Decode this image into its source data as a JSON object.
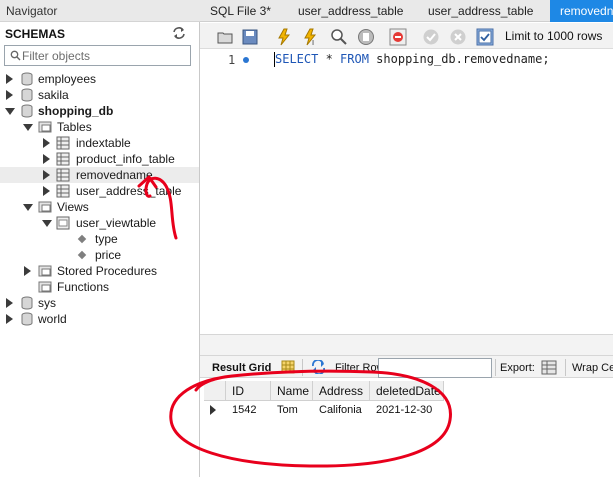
{
  "navigator": {
    "title": "Navigator",
    "schemas_label": "SCHEMAS",
    "filter_placeholder": "Filter objects",
    "tree": {
      "employees": "employees",
      "sakila": "sakila",
      "shopping_db": "shopping_db",
      "tables": "Tables",
      "indextable": "indextable",
      "product_info_table": "product_info_table",
      "removedname": "removedname",
      "user_address_table": "user_address_table",
      "views": "Views",
      "user_viewtable": "user_viewtable",
      "type": "type",
      "price": "price",
      "stored_procedures": "Stored Procedures",
      "functions": "Functions",
      "sys": "sys",
      "world": "world"
    }
  },
  "tabs": [
    "SQL File 3*",
    "user_address_table",
    "user_address_table",
    "removedname"
  ],
  "toolbar": {
    "limit_label": "Limit to 1000 rows"
  },
  "editor": {
    "line_number": "1",
    "sql_keyword_select": "SELECT",
    "sql_star": " * ",
    "sql_keyword_from": "FROM",
    "sql_rest": " shopping_db.removedname;"
  },
  "result": {
    "result_grid_label": "Result Grid",
    "filter_rows_label": "Filter Rows:",
    "filter_rows_value": "",
    "export_label": "Export:",
    "wrap_label": "Wrap Ce",
    "columns": [
      "ID",
      "Name",
      "Address",
      "deletedDate"
    ],
    "rows": [
      [
        "1542",
        "Tom",
        "Califonia",
        "2021-12-30"
      ]
    ]
  },
  "colors": {
    "active_tab": "#1e88e5",
    "annotation_red": "#e8001c",
    "keyword_blue": "#1e56b6"
  },
  "icons": [
    "refresh-icon",
    "search-icon",
    "database-icon",
    "table-icon",
    "view-icon",
    "folder-icon",
    "grid-icon",
    "export-icon"
  ]
}
